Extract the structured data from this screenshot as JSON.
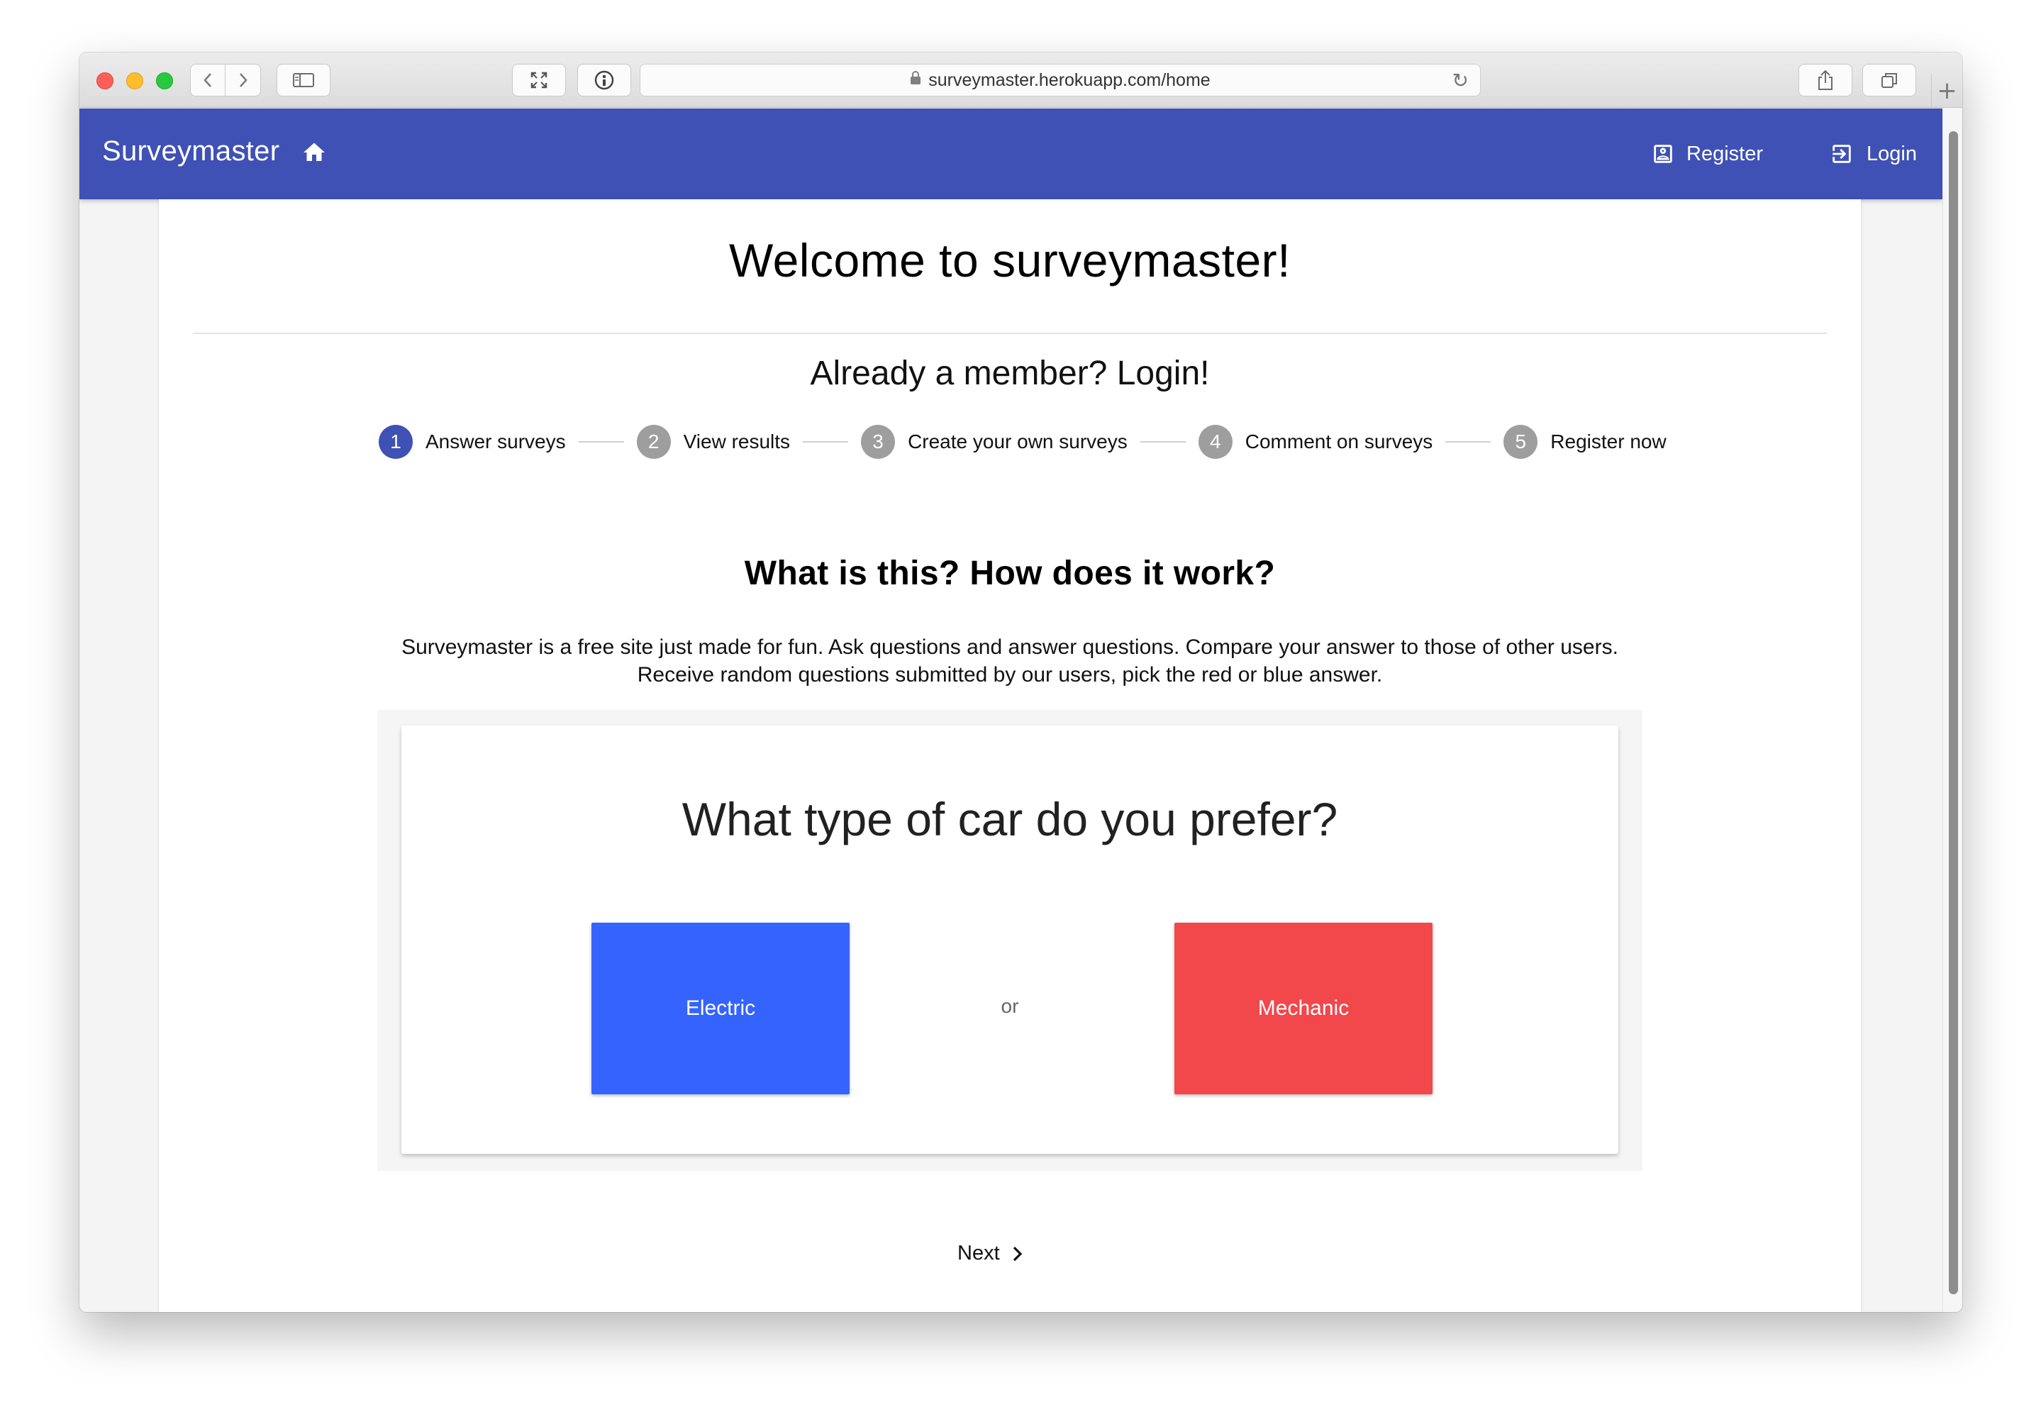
{
  "browser": {
    "url": "surveymaster.herokuapp.com/home"
  },
  "appbar": {
    "brand": "Surveymaster",
    "register_label": "Register",
    "login_label": "Login"
  },
  "main": {
    "welcome_title": "Welcome to surveymaster!",
    "member_prompt": "Already a member? Login!",
    "steps": [
      {
        "number": "1",
        "label": "Answer surveys",
        "active": true
      },
      {
        "number": "2",
        "label": "View results",
        "active": false
      },
      {
        "number": "3",
        "label": "Create your own surveys",
        "active": false
      },
      {
        "number": "4",
        "label": "Comment on surveys",
        "active": false
      },
      {
        "number": "5",
        "label": "Register now",
        "active": false
      }
    ],
    "what_title": "What is this? How does it work?",
    "description": "Surveymaster is a free site just made for fun. Ask questions and answer questions. Compare your answer to those of other users. Receive random questions submitted by our users, pick the red or blue answer.",
    "survey": {
      "question": "What type of car do you prefer?",
      "option_blue": "Electric",
      "separator": "or",
      "option_red": "Mechanic"
    },
    "next_label": "Next"
  },
  "colors": {
    "primary": "#3f51b5",
    "blue_answer": "#3463fe",
    "red_answer": "#f2474b"
  }
}
